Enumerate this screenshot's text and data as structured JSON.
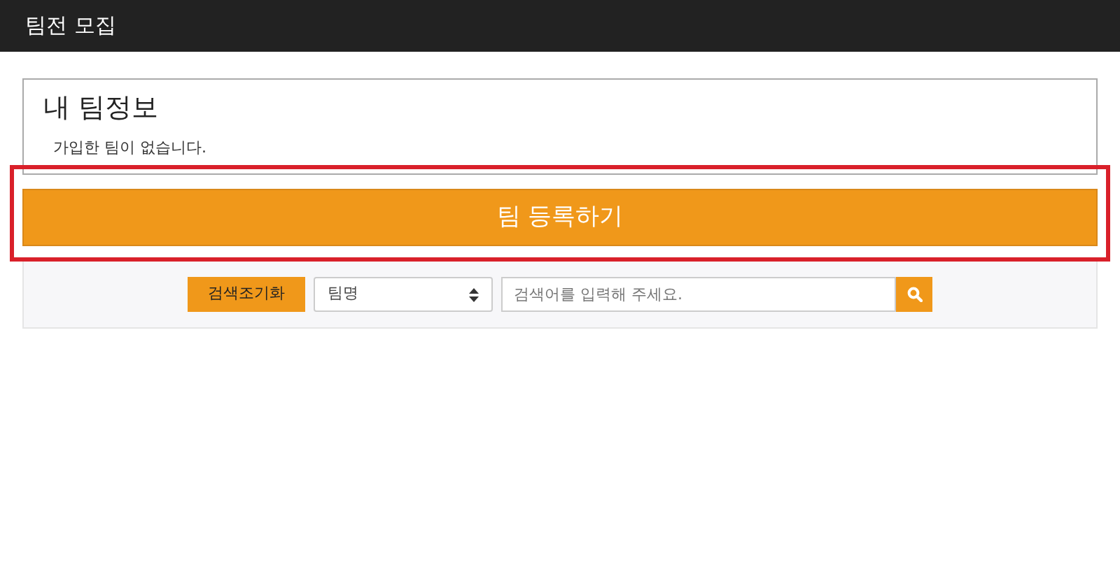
{
  "header": {
    "title": "팀전 모집"
  },
  "my_team": {
    "title": "내 팀정보",
    "message": "가입한 팀이 없습니다."
  },
  "register_button": {
    "label": "팀 등록하기",
    "highlighted": true
  },
  "search": {
    "reset_label": "검색조기화",
    "select_value": "팀명",
    "placeholder": "검색어를 입력해 주세요."
  }
}
